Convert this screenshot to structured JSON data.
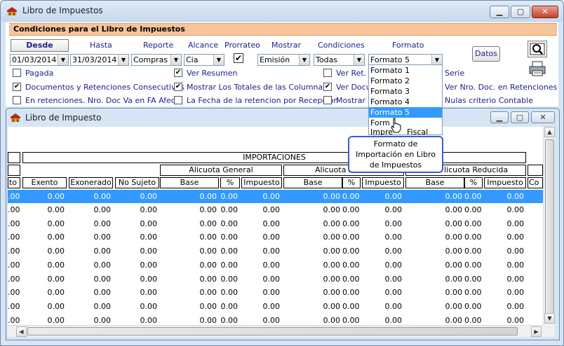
{
  "window": {
    "title": "Libro de Impuestos"
  },
  "conditions": {
    "header": "Condiciones para el Libro de Impuestos",
    "desde_label": "Desde",
    "hasta_label": "Hasta",
    "reporte_label": "Reporte",
    "alcance_label": "Alcance",
    "prorrateo_label": "Prorrateo",
    "mostrar_label": "Mostrar",
    "condiciones_label": "Condiciones",
    "formato_label": "Formato",
    "desde_value": "01/03/2014",
    "hasta_value": "31/03/2014",
    "reporte_value": "Compras",
    "alcance_value": "Cia",
    "mostrar_value": "Emisión",
    "condiciones_value": "Todas",
    "formato_value": "Formato 5",
    "datos_button": "Datos"
  },
  "checkboxes": [
    {
      "label": "Pagada",
      "checked": false
    },
    {
      "label": "Ver Resumen",
      "checked": true
    },
    {
      "label": "Ver Ret. A",
      "checked": false
    },
    {
      "label": "Serie",
      "checked": false
    },
    {
      "label": "Documentos y Retenciones Consecutivas",
      "checked": true
    },
    {
      "label": "Mostrar Los Totales de las Columnas",
      "checked": true
    },
    {
      "label": "Ver Docum",
      "checked": true
    },
    {
      "label": "Ver Nro. Doc. en Retenciones",
      "checked": false
    },
    {
      "label": "En retenciones. Nro. Doc Va en FA Afecta",
      "checked": false
    },
    {
      "label": "La Fecha de la retencion por Recepción",
      "checked": false
    },
    {
      "label": "Mostrar R",
      "checked": false
    },
    {
      "label": "Nulas criterio Contable",
      "checked": false
    }
  ],
  "dropdown": {
    "items": [
      "Formato 1",
      "Formato 2",
      "Formato 3",
      "Formato 4",
      "Formato 5",
      "Form",
      "Impre"
    ],
    "selected_index": 4,
    "extra_text": "Fiscal"
  },
  "tooltip": {
    "line1": "Formato de",
    "line2": "Importación en Libro",
    "line3": "de Impuestos"
  },
  "report": {
    "title": "Libro de Impuesto",
    "group_header": "IMPORTACIONES",
    "sub_general": "Alicuota General",
    "sub_adicional": "Alicuota A",
    "sub_reducida": "licuota Reducida",
    "columns": [
      "to",
      "Exento",
      "Exonerado",
      "No Sujeto",
      "Base",
      "%",
      "Impuesto",
      "Base",
      "%",
      "Impuesto",
      "Base",
      "%",
      "Impuesto",
      "Co"
    ],
    "row_prefix": ".00",
    "cell_value": "0.00"
  },
  "colors": {
    "accent": "#3399ff",
    "header_bar": "#f5c49b",
    "label_text": "#1e1e8c"
  }
}
